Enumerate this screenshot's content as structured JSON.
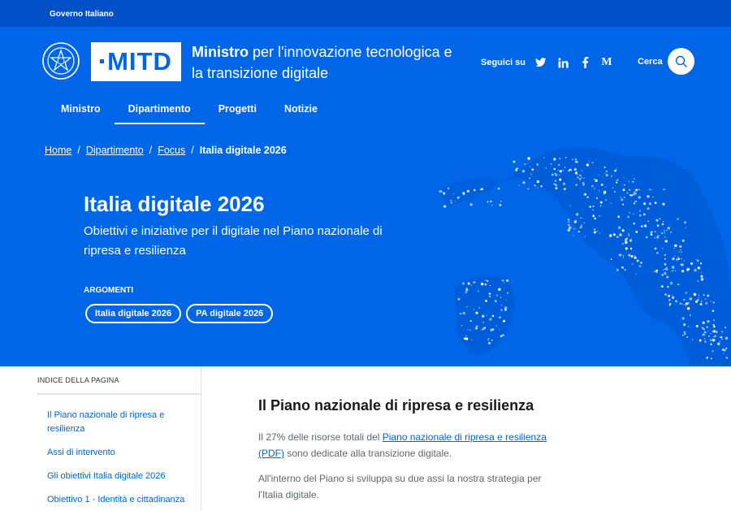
{
  "topbar": {
    "label": "Governo Italiano"
  },
  "header": {
    "logo_text": "MITD",
    "brand_bold": "Ministro",
    "brand_rest": " per l'innovazione tecnologica e la transizione digitale",
    "social_label": "Seguici su",
    "social_icons": [
      "twitter-icon",
      "linkedin-icon",
      "facebook-icon",
      "medium-icon"
    ],
    "search_label": "Cerca"
  },
  "nav": {
    "items": [
      {
        "label": "Ministro",
        "active": false
      },
      {
        "label": "Dipartimento",
        "active": true
      },
      {
        "label": "Progetti",
        "active": false
      },
      {
        "label": "Notizie",
        "active": false
      }
    ]
  },
  "breadcrumb": {
    "items": [
      "Home",
      "Dipartimento",
      "Focus"
    ],
    "separator": "/",
    "current": "Italia digitale 2026"
  },
  "hero": {
    "title": "Italia digitale 2026",
    "subtitle": "Obiettivi e iniziative per il digitale nel Piano nazionale di ripresa e resilienza",
    "topics_label": "ARGOMENTI",
    "topics": [
      "Italia digitale 2026",
      "PA digitale 2026"
    ]
  },
  "toc": {
    "title": "INDICE DELLA PAGINA",
    "links": [
      "Il Piano nazionale di ripresa e resilienza",
      "Assi di intervento",
      "Gli obiettivi Italia digitale 2026",
      "Obiettivo 1 - Identità e cittadinanza"
    ]
  },
  "content": {
    "heading": "Il Piano nazionale di ripresa e resilienza",
    "p1_before": "Il 27% delle risorse totali del ",
    "p1_link": "Piano nazionale di ripresa e resilienza (PDF)",
    "p1_after": " sono dedicate alla transizione digitale.",
    "p2": "All'interno del Piano si sviluppa su due assi la nostra strategia per l'Italia digitale."
  },
  "colors": {
    "primary_blue": "#0066e8",
    "topbar_blue": "#0051c8",
    "link_blue": "#0066cc",
    "white": "#ffffff"
  }
}
